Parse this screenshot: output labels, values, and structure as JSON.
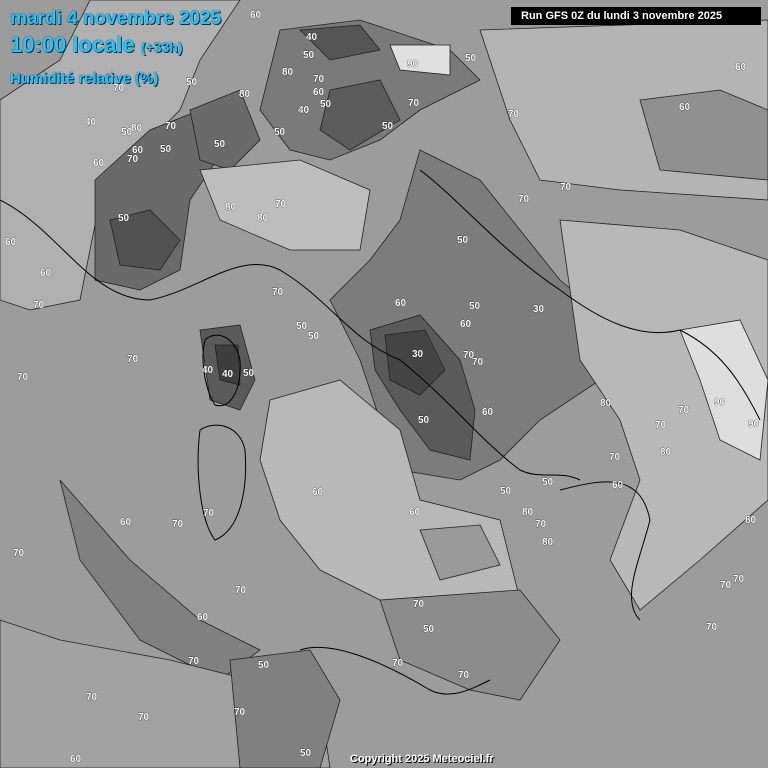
{
  "header": {
    "date": "mardi 4 novembre 2025",
    "time": "10:00 locale",
    "offset": "(+33h)",
    "variable": "Humidité relative (%)"
  },
  "run_info": "Run GFS 0Z du lundi 3 novembre 2025",
  "copyright": "Copyright 2025 Meteociel.fr",
  "colors": {
    "title": "#1ec8ff",
    "base": "#9c9c9c",
    "dark": "#5a5a5a",
    "darker": "#444444",
    "light": "#bdbdbd",
    "lighter": "#dcdcdc"
  },
  "contour_labels": [
    "60",
    "40",
    "50",
    "50",
    "90",
    "50",
    "60",
    "80",
    "70",
    "60",
    "80",
    "50",
    "70",
    "50",
    "70",
    "60",
    "70",
    "50",
    "40",
    "50",
    "80",
    "70",
    "50",
    "60",
    "70",
    "50",
    "40",
    "60",
    "70",
    "70",
    "80",
    "80",
    "50",
    "70",
    "60",
    "70",
    "60",
    "50",
    "50",
    "60",
    "50",
    "30",
    "40",
    "70",
    "30",
    "40",
    "50",
    "70",
    "60",
    "50",
    "50",
    "60",
    "70",
    "80",
    "70",
    "70",
    "90",
    "90",
    "70",
    "80",
    "60",
    "70",
    "70",
    "50",
    "50",
    "80",
    "70",
    "80",
    "70",
    "60",
    "70",
    "80",
    "70",
    "60",
    "60",
    "70",
    "70",
    "70",
    "60",
    "70",
    "50",
    "50",
    "70",
    "70",
    "70",
    "70",
    "50",
    "70",
    "60",
    "70",
    "70"
  ]
}
